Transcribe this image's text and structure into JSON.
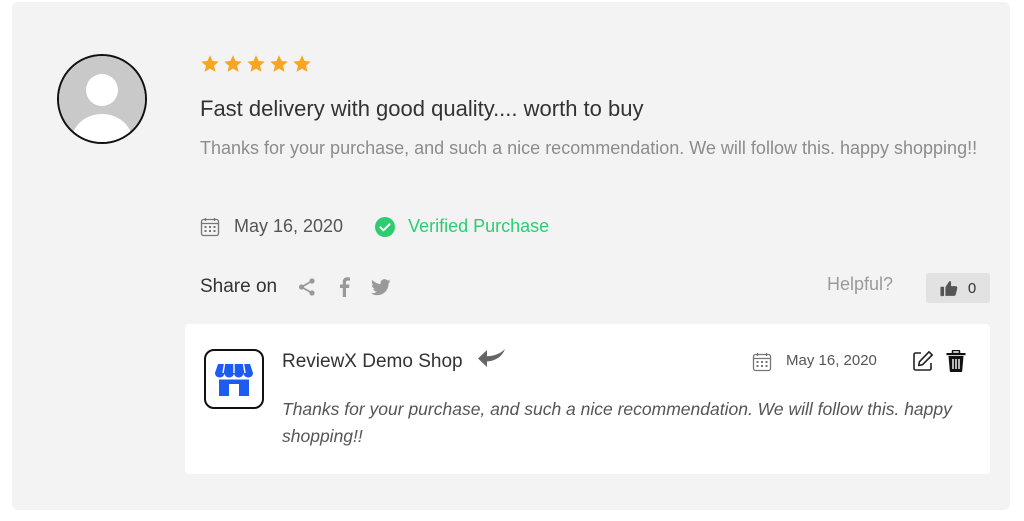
{
  "review": {
    "rating": 5,
    "max_rating": 5,
    "title": "Fast delivery with good quality.... worth to buy",
    "text": "Thanks for your purchase, and such a nice recommendation. We will follow this. happy shopping!!",
    "date": "May 16, 2020",
    "verified_label": "Verified Purchase",
    "share_label": "Share on",
    "share_icons": [
      "share-icon",
      "facebook-icon",
      "twitter-icon"
    ],
    "helpful_label": "Helpful?",
    "helpful_count": "0"
  },
  "reply": {
    "shop_name": "ReviewX Demo Shop",
    "date": "May 16, 2020",
    "text": "Thanks for your purchase, and such a nice recommendation. We will follow this. happy shopping!!"
  },
  "colors": {
    "star": "#f5a623",
    "verified": "#2ecc71",
    "shop_logo": "#1e5bf0",
    "card_bg": "#f3f3f4"
  }
}
